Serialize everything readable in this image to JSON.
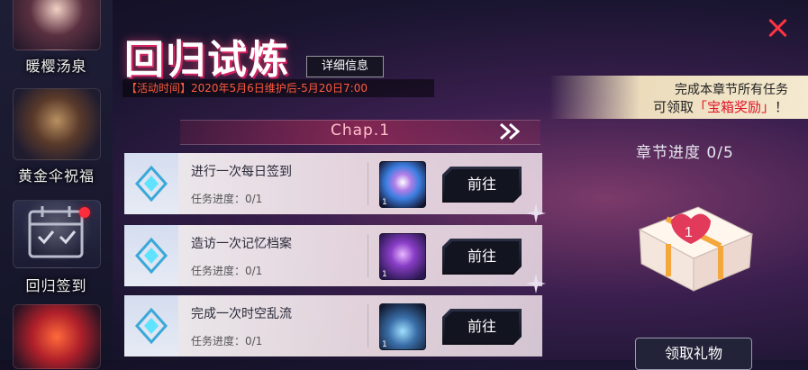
{
  "sidebar": {
    "items": [
      {
        "label": "暖樱汤泉"
      },
      {
        "label": "黄金伞祝福"
      },
      {
        "label": "回归签到",
        "has_notification": true
      },
      {
        "label": ""
      }
    ]
  },
  "header": {
    "title": "回归试炼",
    "details_label": "详细信息",
    "event_time": "【活动时间】2020年5月6日维护后-5月20日7:00"
  },
  "reward": {
    "line1": "完成本章节所有任务",
    "line2_prefix": "可领取",
    "line2_highlight": "「宝箱奖励」",
    "line2_suffix": "！",
    "progress_label": "章节进度 0/5",
    "claim_label": "领取礼物"
  },
  "chapter": {
    "label": "Chap.1"
  },
  "tasks": [
    {
      "name": "进行一次每日签到",
      "progress": "任务进度：0/1",
      "item_count": "1",
      "button": "前往"
    },
    {
      "name": "造访一次记忆档案",
      "progress": "任务进度：0/1",
      "item_count": "1",
      "button": "前往"
    },
    {
      "name": "完成一次时空乱流",
      "progress": "任务进度：0/1",
      "item_count": "1",
      "button": "前往"
    }
  ],
  "colors": {
    "accent_red": "#ff3344",
    "time_text": "#ff5a3c",
    "reward_highlight": "#e0142a",
    "diamond": "#5fe3ff"
  }
}
